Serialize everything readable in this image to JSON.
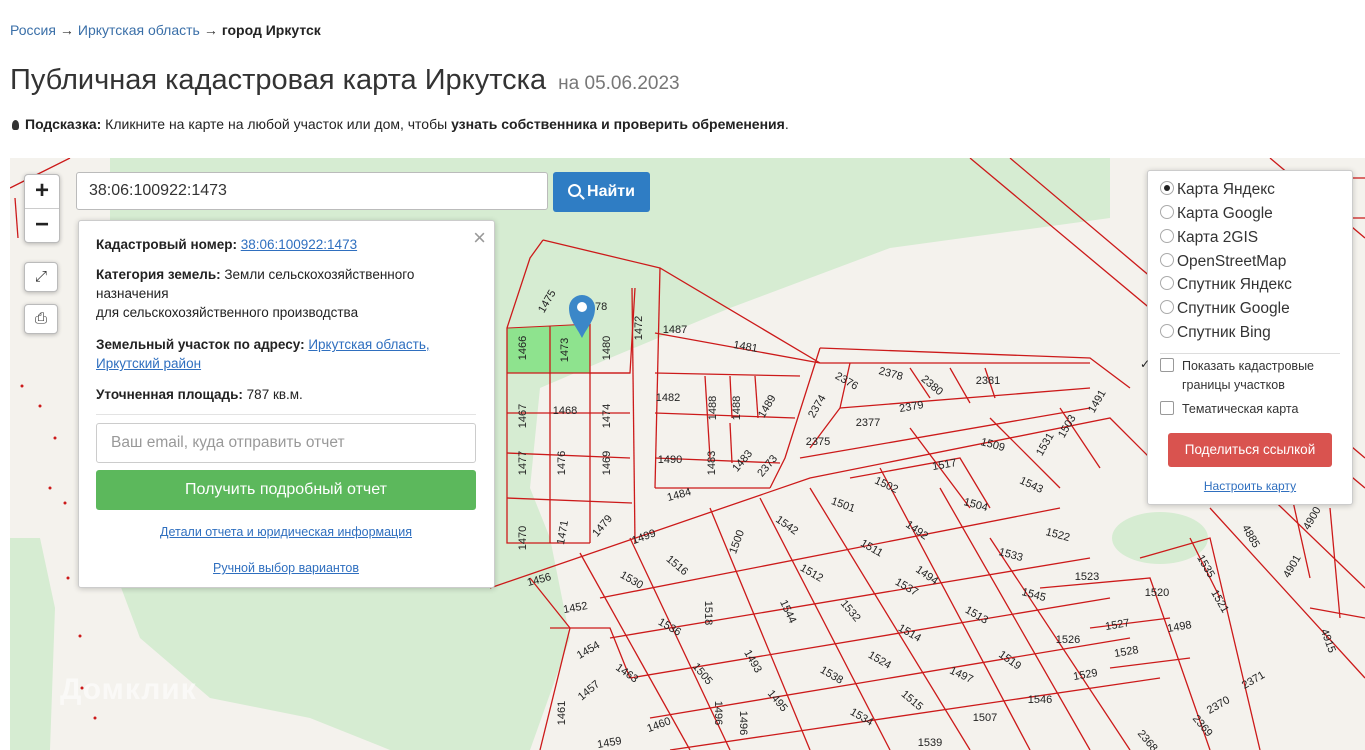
{
  "breadcrumbs": {
    "item1": "Россия",
    "item2": "Иркутская область",
    "current": "город Иркутск",
    "sep": "→"
  },
  "title": {
    "main": "Публичная кадастровая карта Иркутска",
    "date": "на 05.06.2023"
  },
  "hint": {
    "label": "Подсказка:",
    "text": " Кликните на карте на любой участок или дом, чтобы ",
    "bold": "узнать собственника и проверить обременения",
    "end": "."
  },
  "map": {
    "zoom_in": "+",
    "zoom_out": "−",
    "search_value": "38:06:100922:1473",
    "find_label": "Найти",
    "watermark": "Домклик",
    "colors": {
      "parcel_line": "#cc1a1a",
      "forest": "#d6ecd2",
      "selected": "#8ee38e",
      "marker": "#3b87c8"
    },
    "parcel_labels": [
      "1475",
      "1478",
      "1472",
      "1487",
      "1481",
      "1466",
      "1473",
      "1480",
      "1467",
      "1468",
      "1474",
      "1482",
      "1488",
      "1488",
      "1489",
      "2374",
      "2376",
      "2378",
      "2380",
      "2381",
      "2379",
      "1491",
      "1503",
      "2377",
      "2375",
      "1477",
      "1476",
      "1469",
      "1490",
      "1483",
      "1483",
      "2373",
      "1509",
      "1531",
      "1517",
      "1543",
      "1484",
      "1502",
      "1501",
      "1492",
      "1504",
      "1470",
      "1471",
      "1479",
      "1499",
      "1500",
      "1542",
      "1511",
      "1522",
      "1533",
      "1456",
      "1530",
      "1516",
      "1512",
      "1537",
      "1494",
      "1523",
      "1545",
      "1520",
      "1535",
      "1521",
      "1452",
      "1518",
      "1544",
      "1532",
      "1513",
      "1527",
      "1498",
      "1536",
      "1514",
      "1526",
      "1454",
      "1463",
      "1505",
      "1493",
      "1524",
      "1519",
      "1528",
      "1529",
      "1457",
      "1538",
      "1497",
      "1461",
      "1460",
      "1496",
      "1496",
      "1495",
      "1534",
      "1515",
      "1507",
      "1546",
      "2371",
      "2370",
      "2369",
      "1459",
      "1539",
      "2368",
      "4885",
      "4900",
      "4901",
      "4915"
    ]
  },
  "popup": {
    "close": "×",
    "cad_label": "Кадастровый номер:",
    "cad_value": "38:06:100922:1473",
    "cat_label": "Категория земель:",
    "cat_value": " Земли сельскохозяйственного назначения",
    "cat_value2": "для сельскохозяйственного производства",
    "addr_label": "Земельный участок по адресу:",
    "addr_value": "Иркутская область, Иркутский район",
    "area_label": "Уточненная площадь:",
    "area_value": " 787 кв.м.",
    "email_placeholder": "Ваш email, куда отправить отчет",
    "report_button": "Получить подробный отчет",
    "details_link": "Детали отчета и юридическая информация",
    "manual_link": "Ручной выбор вариантов"
  },
  "layers": {
    "options": [
      {
        "label": "Карта Яндекс",
        "selected": true
      },
      {
        "label": "Карта Google",
        "selected": false
      },
      {
        "label": "Карта 2GIS",
        "selected": false
      },
      {
        "label": "OpenStreetMap",
        "selected": false
      },
      {
        "label": "Спутник Яндекс",
        "selected": false
      },
      {
        "label": "Спутник Google",
        "selected": false
      },
      {
        "label": "Спутник Bing",
        "selected": false
      }
    ],
    "cadastral_label": "Показать кадастровые границы участков",
    "cadastral_checked": true,
    "thematic_label": "Тематическая карта",
    "thematic_checked": false,
    "share_button": "Поделиться ссылкой",
    "configure_link": "Настроить карту"
  }
}
